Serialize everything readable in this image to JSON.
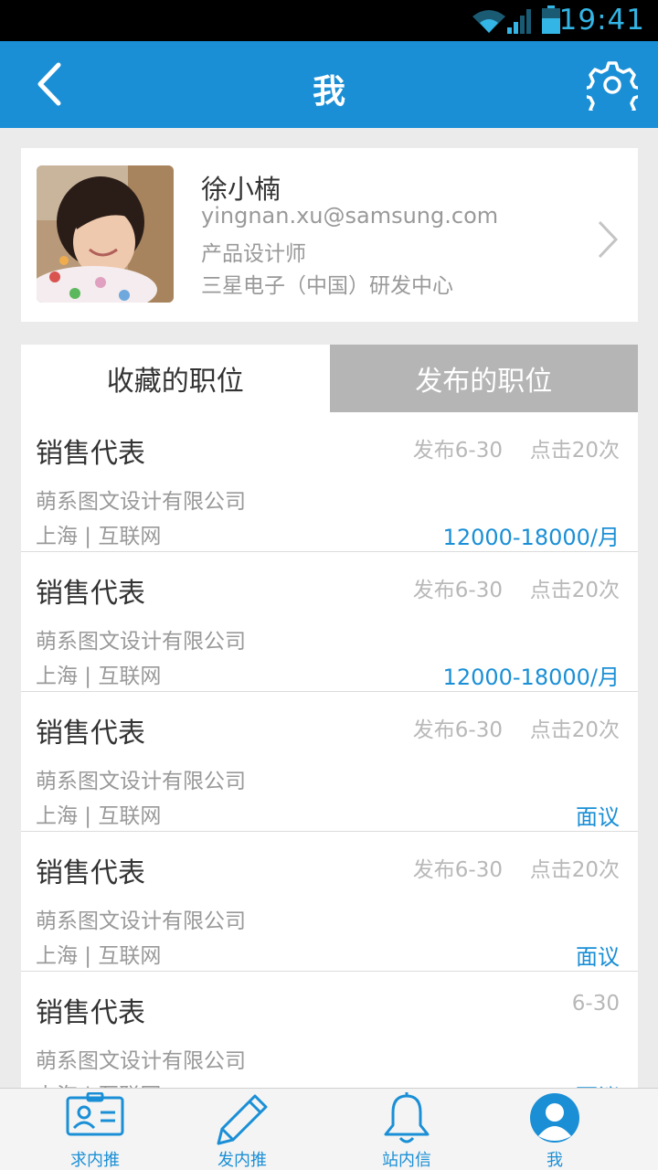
{
  "status_bar": {
    "time": "19:41"
  },
  "header": {
    "title": "我"
  },
  "profile": {
    "name": "徐小楠",
    "email": "yingnan.xu@samsung.com",
    "job_title": "产品设计师",
    "company": "三星电子（中国）研发中心"
  },
  "tabs": [
    {
      "label": "收藏的职位",
      "active": true
    },
    {
      "label": "发布的职位",
      "active": false
    }
  ],
  "jobs": [
    {
      "title": "销售代表",
      "date": "发布6-30",
      "clicks": "点击20次",
      "company": "萌系图文设计有限公司",
      "location": "上海 | 互联网",
      "salary": "12000-18000/月"
    },
    {
      "title": "销售代表",
      "date": "发布6-30",
      "clicks": "点击20次",
      "company": "萌系图文设计有限公司",
      "location": "上海 | 互联网",
      "salary": "12000-18000/月"
    },
    {
      "title": "销售代表",
      "date": "发布6-30",
      "clicks": "点击20次",
      "company": "萌系图文设计有限公司",
      "location": "上海 | 互联网",
      "salary": "面议"
    },
    {
      "title": "销售代表",
      "date": "发布6-30",
      "clicks": "点击20次",
      "company": "萌系图文设计有限公司",
      "location": "上海 | 互联网",
      "salary": "面议"
    },
    {
      "title": "销售代表",
      "date": "6-30",
      "company": "萌系图文设计有限公司",
      "location": "上海 | 互联网",
      "salary": "面议"
    }
  ],
  "bottom_nav": [
    {
      "label": "求内推",
      "icon": "id-card-icon"
    },
    {
      "label": "发内推",
      "icon": "pencil-icon"
    },
    {
      "label": "站内信",
      "icon": "bell-icon"
    },
    {
      "label": "我",
      "icon": "user-icon"
    }
  ],
  "colors": {
    "accent": "#1a8fd6",
    "status_blue": "#33b5e5",
    "inactive_tab": "#b5b5b5"
  }
}
